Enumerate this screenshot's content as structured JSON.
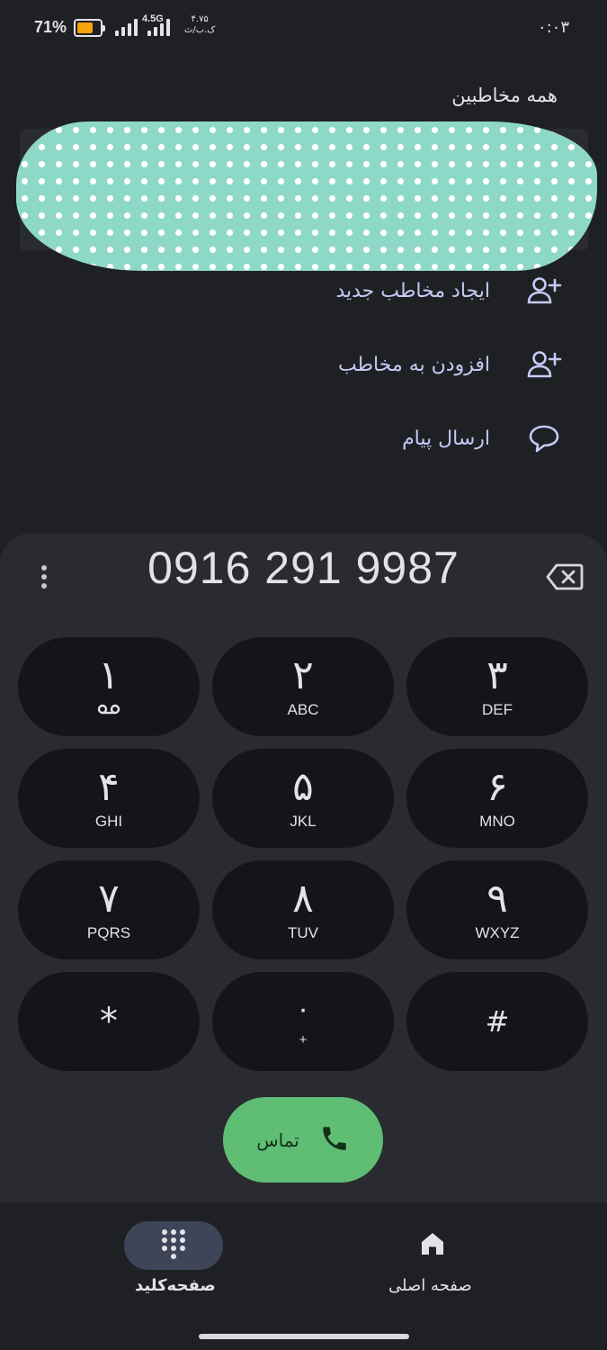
{
  "status_bar": {
    "battery_percent": "71%",
    "battery_level": 0.71,
    "battery_color": "#f5a30a",
    "network_type": "4.5G",
    "speed_value": "۴.۷۵",
    "speed_unit": "ک.ب/ث",
    "time": "۰:۰۳"
  },
  "suggestions": {
    "title": "همه مخاطبین",
    "actions": [
      {
        "label": "ایجاد مخاطب جدید",
        "icon": "person-add-icon"
      },
      {
        "label": "افزودن به مخاطب",
        "icon": "person-add-icon"
      },
      {
        "label": "ارسال پیام",
        "icon": "message-bubble-icon"
      }
    ]
  },
  "dialer": {
    "number": "0916 291 9987",
    "keys": [
      {
        "digit": "۱",
        "letters": "ᴑᴑ",
        "icon": "voicemail-icon"
      },
      {
        "digit": "۲",
        "letters": "ABC"
      },
      {
        "digit": "۳",
        "letters": "DEF"
      },
      {
        "digit": "۴",
        "letters": "GHI"
      },
      {
        "digit": "۵",
        "letters": "JKL"
      },
      {
        "digit": "۶",
        "letters": "MNO"
      },
      {
        "digit": "۷",
        "letters": "PQRS"
      },
      {
        "digit": "۸",
        "letters": "TUV"
      },
      {
        "digit": "۹",
        "letters": "WXYZ"
      },
      {
        "digit": "*",
        "letters": ""
      },
      {
        "digit": "۰",
        "letters": "+"
      },
      {
        "digit": "#",
        "letters": ""
      }
    ],
    "call_label": "تماس"
  },
  "bottom_nav": {
    "items": [
      {
        "label": "صفحه‌کلید",
        "icon": "dialpad-icon",
        "selected": true
      },
      {
        "label": "صفحه اصلی",
        "icon": "home-icon",
        "selected": false
      }
    ]
  },
  "colors": {
    "background": "#1f2024",
    "panel": "#2a2b30",
    "key": "#141518",
    "accent_text": "#c5caf5",
    "call_button": "#5fbd74",
    "nav_selected": "#3e4558"
  }
}
